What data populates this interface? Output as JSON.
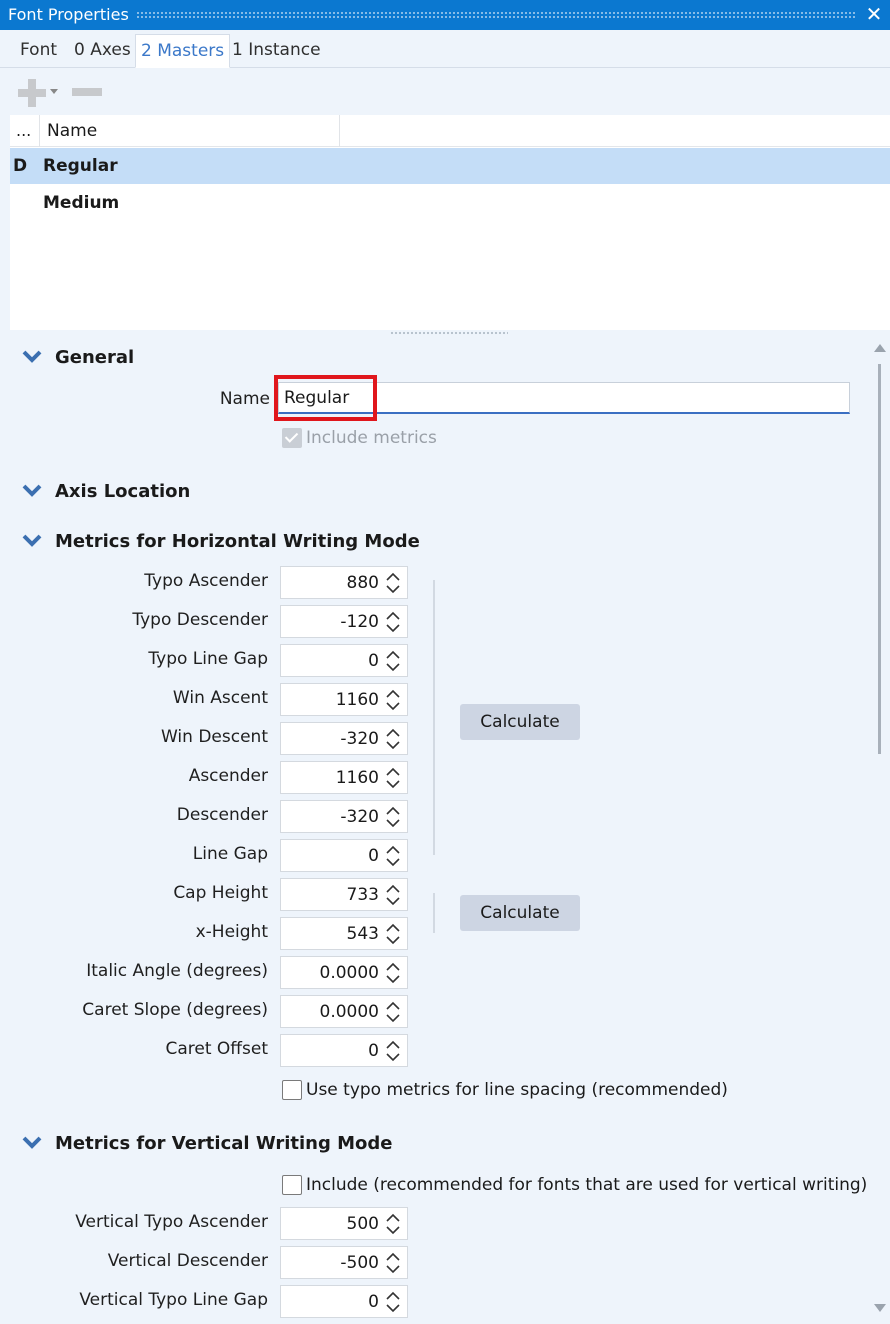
{
  "window": {
    "title": "Font Properties"
  },
  "tabs": [
    {
      "label": "Font"
    },
    {
      "label": "0 Axes"
    },
    {
      "label": "2 Masters"
    },
    {
      "label": "1 Instance"
    }
  ],
  "table": {
    "headers": [
      "...",
      "Name"
    ],
    "rows": [
      {
        "marker": "D",
        "name": "Regular"
      },
      {
        "marker": "",
        "name": "Medium"
      }
    ]
  },
  "general": {
    "title": "General",
    "name_label": "Name",
    "name_value": "Regular",
    "include_metrics": "Include metrics"
  },
  "axis_location": {
    "title": "Axis Location"
  },
  "horizontal": {
    "title": "Metrics for Horizontal Writing Mode",
    "fields": [
      {
        "label": "Typo Ascender",
        "value": "880"
      },
      {
        "label": "Typo Descender",
        "value": "-120"
      },
      {
        "label": "Typo Line Gap",
        "value": "0"
      },
      {
        "label": "Win Ascent",
        "value": "1160"
      },
      {
        "label": "Win Descent",
        "value": "-320"
      },
      {
        "label": "Ascender",
        "value": "1160"
      },
      {
        "label": "Descender",
        "value": "-320"
      },
      {
        "label": "Line Gap",
        "value": "0"
      },
      {
        "label": "Cap Height",
        "value": "733"
      },
      {
        "label": "x-Height",
        "value": "543"
      },
      {
        "label": "Italic Angle (degrees)",
        "value": "0.0000"
      },
      {
        "label": "Caret Slope (degrees)",
        "value": "0.0000"
      },
      {
        "label": "Caret Offset",
        "value": "0"
      }
    ],
    "calculate_1": "Calculate",
    "calculate_2": "Calculate",
    "use_typo": "Use typo metrics for line spacing (recommended)"
  },
  "vertical": {
    "title": "Metrics for Vertical Writing Mode",
    "include": "Include (recommended for fonts that are used for vertical writing)",
    "fields": [
      {
        "label": "Vertical Typo Ascender",
        "value": "500"
      },
      {
        "label": "Vertical Descender",
        "value": "-500"
      },
      {
        "label": "Vertical Typo Line Gap",
        "value": "0"
      }
    ]
  }
}
